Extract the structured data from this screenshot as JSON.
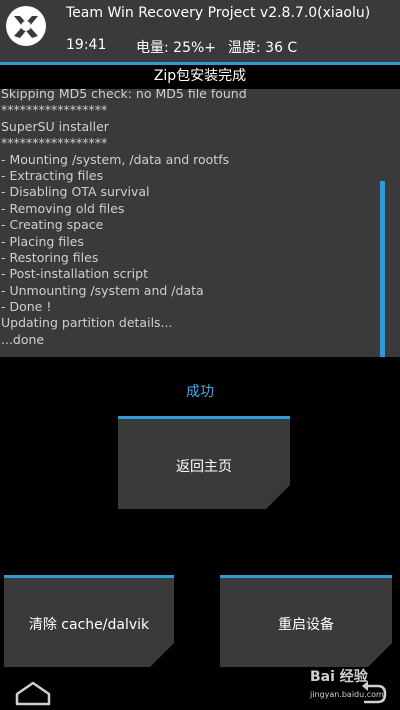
{
  "header": {
    "title": "Team Win Recovery Project  v2.8.7.0(xiaolu)",
    "time": "19:41",
    "battery": "电量: 25%+",
    "temperature": "温度: 36 C"
  },
  "status_text": "Zip包安装完成",
  "console_lines": [
    "Skipping MD5 check: no MD5 file found",
    "*****************",
    "SuperSU installer",
    "*****************",
    "- Mounting /system, /data and rootfs",
    "- Extracting files",
    "- Disabling OTA survival",
    "- Removing old files",
    "- Creating space",
    "- Placing files",
    "- Restoring files",
    "- Post-installation script",
    "- Unmounting /system and /data",
    "- Done !",
    "Updating partition details...",
    "...done"
  ],
  "result_text": "成功",
  "buttons": {
    "home": "返回主页",
    "wipe_cache": "清除 cache/dalvik",
    "reboot": "重启设备"
  },
  "watermark": {
    "logo": "Bai 经验",
    "url": "jingyan.baidu.com"
  },
  "colors": {
    "accent": "#2e9bd6",
    "panel": "#3a3a3a",
    "success": "#4aa8e0"
  }
}
